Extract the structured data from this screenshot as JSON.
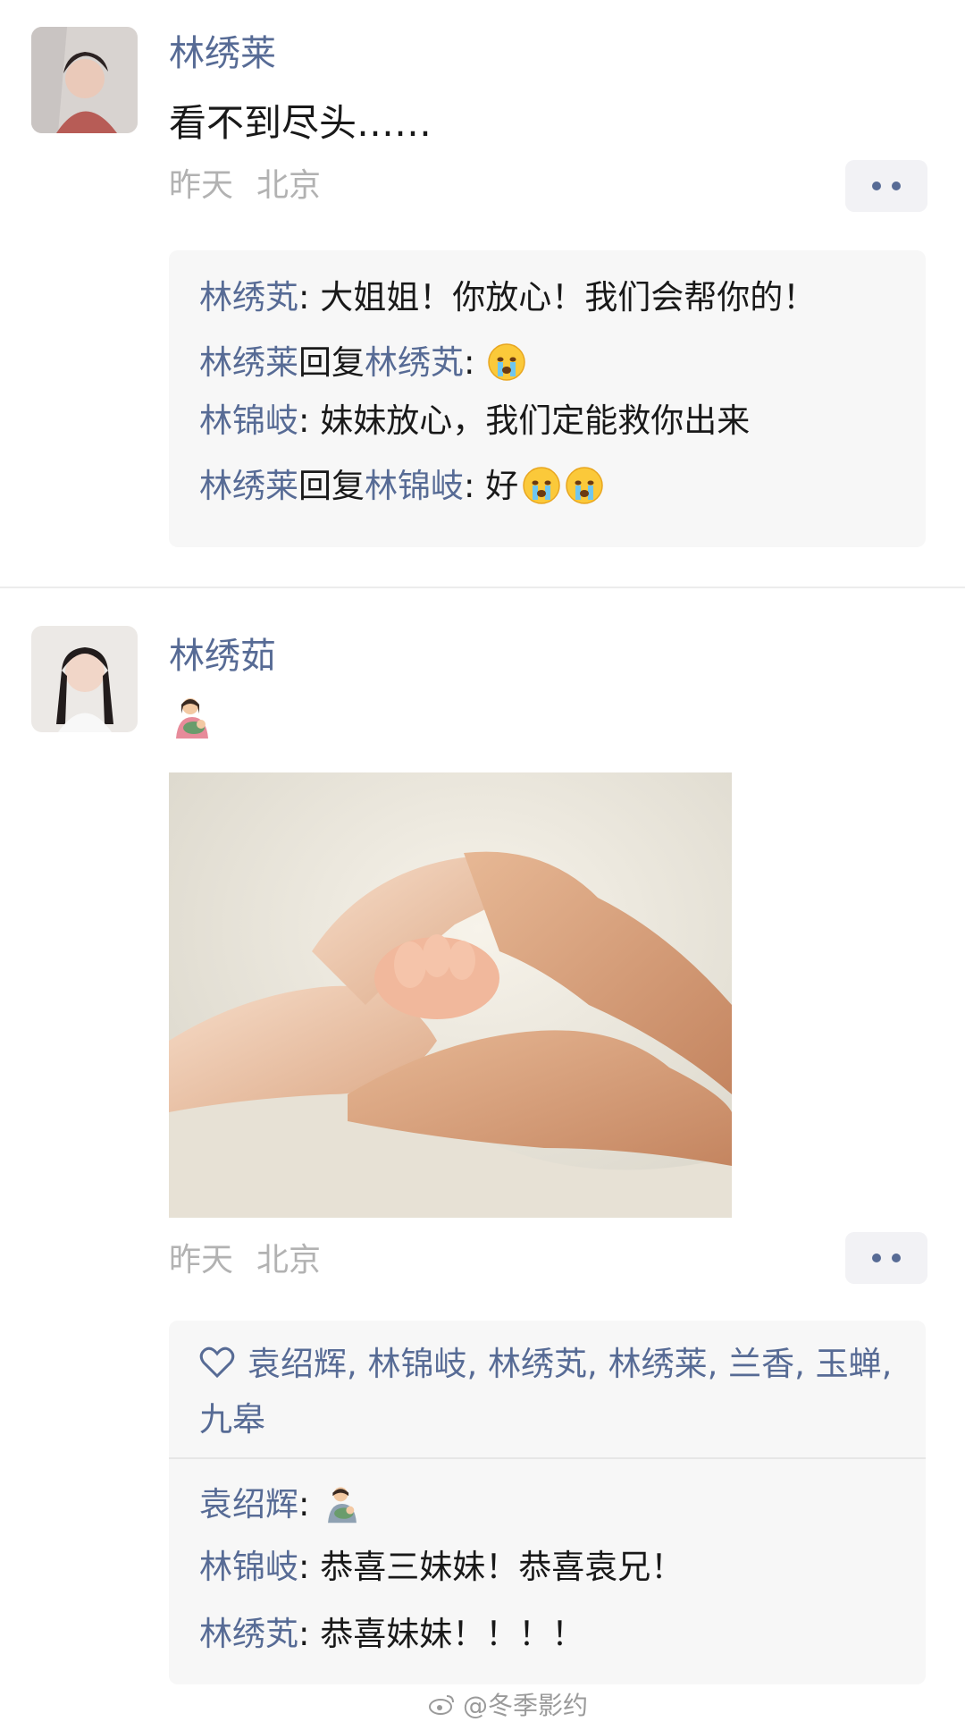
{
  "posts": [
    {
      "author": "林绣莱",
      "text": "看不到尽头……",
      "time": "昨天",
      "location": "北京",
      "comments": [
        {
          "name": "林绣芄",
          "text": ": 大姐姐！你放心！我们会帮你的！"
        },
        {
          "name": "林绣莱",
          "reply_word": "回复",
          "reply_to": "林绣芄",
          "text": ":",
          "emoji_count": 1
        },
        {
          "name": "林锦岐",
          "text": ": 妹妹放心，我们定能救你出来"
        },
        {
          "name": "林绣莱",
          "reply_word": "回复",
          "reply_to": "林锦岐",
          "text": ": 好",
          "emoji_count": 2
        }
      ]
    },
    {
      "author": "林绣茹",
      "text_emoji": "🤱",
      "time": "昨天",
      "location": "北京",
      "likes": "袁绍辉, 林锦岐, 林绣芄, 林绣莱, 兰香, 玉蝉, 九皋",
      "comments": [
        {
          "name": "袁绍辉",
          "text": ":",
          "emoji": "🤱"
        },
        {
          "name": "林锦岐",
          "text": ": 恭喜三妹妹！恭喜袁兄！"
        },
        {
          "name": "林绣芄",
          "text": ": 恭喜妹妹！！！！"
        }
      ]
    }
  ],
  "watermark": "@冬季影约",
  "colors": {
    "link": "#576b95",
    "meta": "#b2b2b2",
    "box": "#f7f7f7"
  }
}
